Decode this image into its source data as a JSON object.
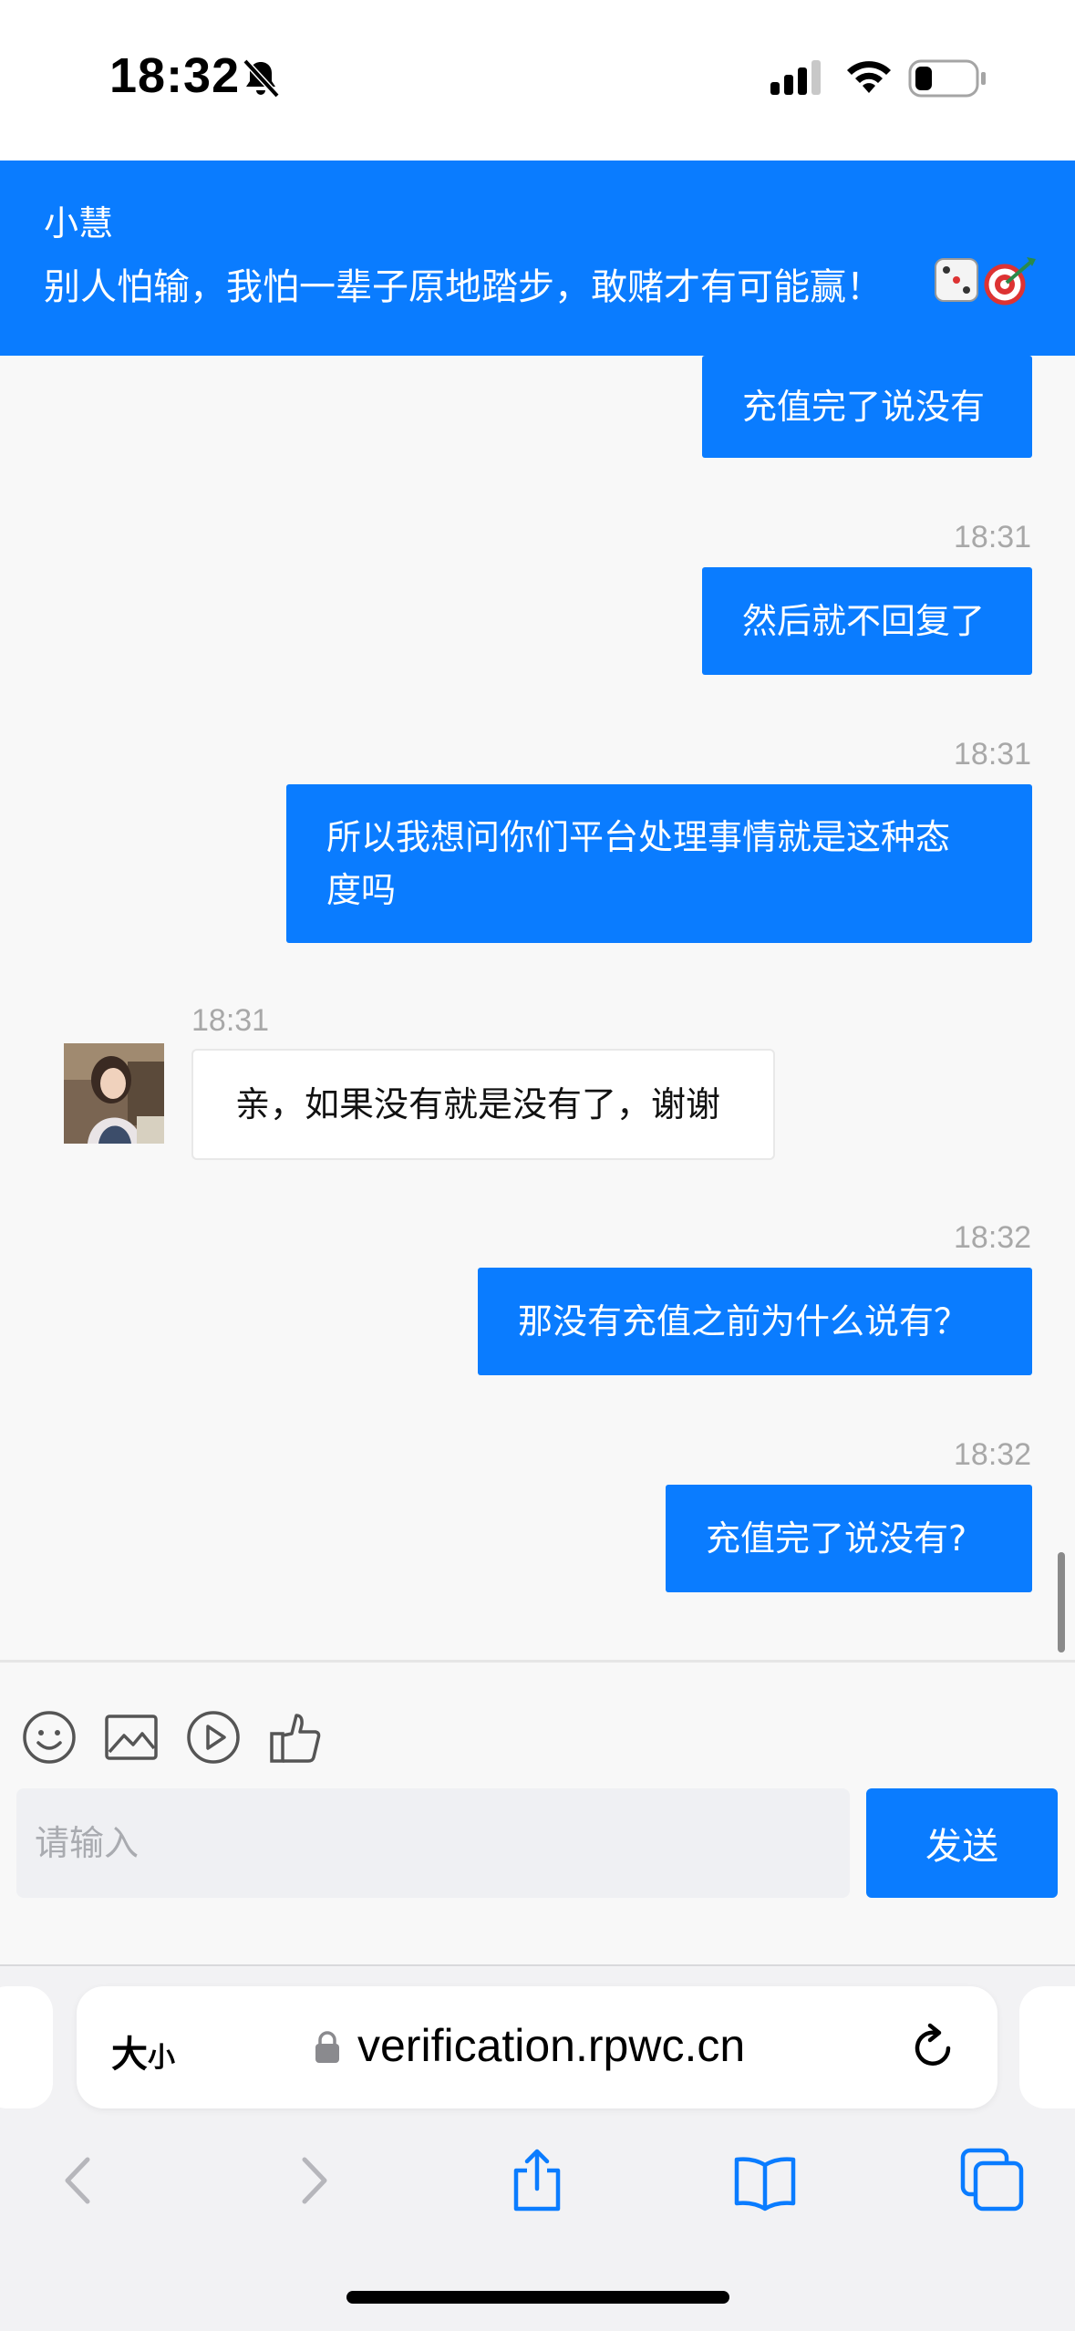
{
  "status_bar": {
    "time": "18:32"
  },
  "header": {
    "agent_name": "小慧",
    "agent_motto": "别人怕输，我怕一辈子原地踏步，敢赌才有可能赢！"
  },
  "messages": [
    {
      "direction": "out",
      "text": "充值完了说没有"
    },
    {
      "direction": "out",
      "time": "18:31",
      "text": "然后就不回复了"
    },
    {
      "direction": "out",
      "time": "18:31",
      "text_line1": "所以我想问你们平台处理事情就是这种态",
      "text_line2": "度吗"
    },
    {
      "direction": "in",
      "time": "18:31",
      "text": "亲，如果没有就是没有了，谢谢"
    },
    {
      "direction": "out",
      "time": "18:32",
      "text": "那没有充值之前为什么说有？"
    },
    {
      "direction": "out",
      "time": "18:32",
      "text": "充值完了说没有?"
    }
  ],
  "composer": {
    "tools": [
      "smiley-icon",
      "image-icon",
      "video-play-icon",
      "thumbs-up-icon"
    ],
    "input_placeholder": "请输入",
    "send_label": "发送"
  },
  "browser": {
    "text_size_label": "大",
    "text_size_small": "小",
    "url": "verification.rpwc.cn",
    "nav": [
      "back-icon",
      "forward-icon",
      "share-icon",
      "bookmarks-icon",
      "tabs-icon"
    ]
  },
  "colors": {
    "accent": "#0a7cff",
    "chat_bg": "#f8f8f8",
    "timestamp": "#a8a8a8"
  }
}
